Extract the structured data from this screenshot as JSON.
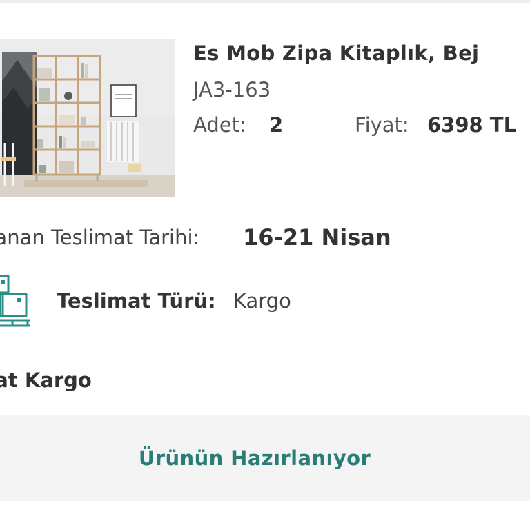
{
  "product": {
    "title": "Es Mob Zipa Kitaplık, Bej",
    "sku": "JA3-163",
    "quantity_label": "Adet:",
    "quantity_value": "2",
    "price_label": "Fiyat:",
    "price_value": "6398 TL",
    "image_icon": "bookshelf-product-photo"
  },
  "delivery": {
    "date_label": "nlanan Teslimat Tarihi:",
    "date_value": "16-21 Nisan",
    "type_label": "Teslimat Türü:",
    "type_value": "Kargo",
    "type_icon": "boxes-on-pallet-icon",
    "carrier": "rat Kargo"
  },
  "status": {
    "text": "Ürünün Hazırlanıyor"
  },
  "colors": {
    "accent": "#2a7d77",
    "status_background": "#f4f4f4",
    "text_primary": "#333333"
  }
}
